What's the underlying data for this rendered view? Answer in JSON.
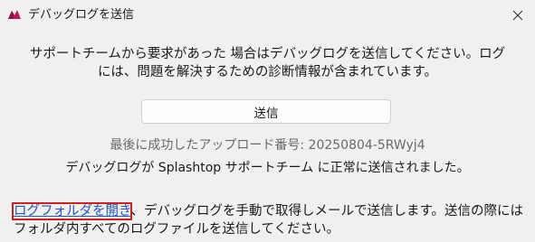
{
  "window": {
    "title": "デバッグログを送信",
    "app_icon": "splashtop-icon",
    "close_icon": "close-icon"
  },
  "message": {
    "line1": "サポートチームから要求があった 場合はデバッグログを送信してください。ログ",
    "line2": "には、問題を解決するための診断情報が含まれています。"
  },
  "send_button": {
    "label": "送信"
  },
  "last_upload": {
    "label": "最後に成功したアップロード番号:",
    "number": "20250804-5RWyj4"
  },
  "status_text": "デバッグログが Splashtop サポートチーム に正常に送信されました。",
  "folder": {
    "link_label": "ログフォルダを開き",
    "description": "、デバッグログを手動で取得しメールで送信します。送信の際にはフォルダ内すべてのログファイルを送信してください。"
  },
  "colors": {
    "background": "#f0f0f0",
    "link": "#1f56c8",
    "highlight_border": "#d0201c",
    "icon_accent": "#c2185b"
  }
}
